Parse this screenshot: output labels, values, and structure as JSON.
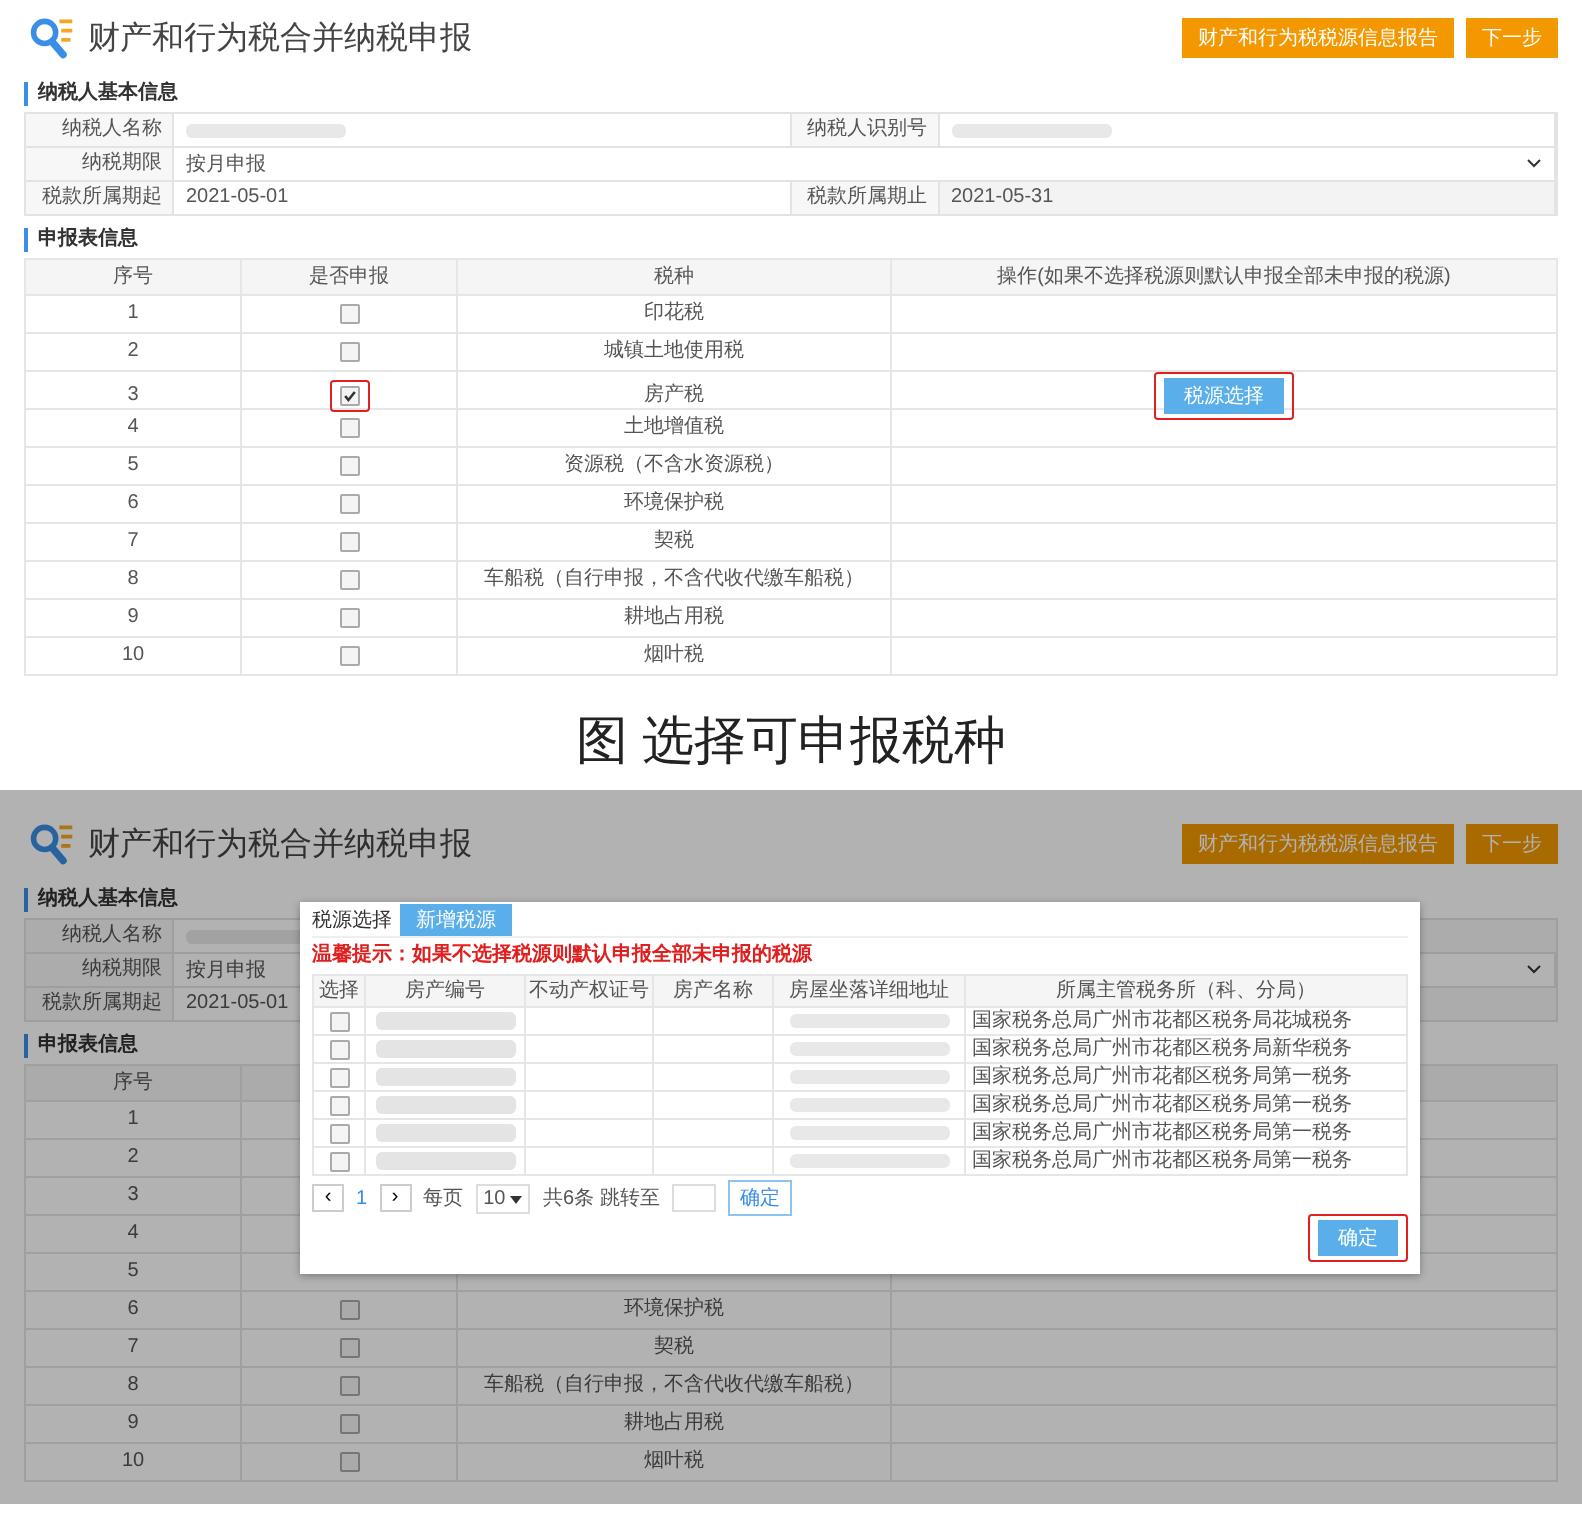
{
  "figure_top": {
    "header": {
      "title": "财产和行为税合并纳税申报",
      "buttons": [
        "财产和行为税税源信息报告",
        "下一步"
      ]
    },
    "taxpayer": {
      "title": "纳税人基本信息",
      "rows": [
        [
          {
            "label": "纳税人名称",
            "kind": "redacted"
          },
          {
            "label": "纳税人识别号",
            "kind": "redacted"
          }
        ],
        [
          {
            "label": "纳税期限",
            "kind": "select",
            "value": "按月申报"
          }
        ],
        [
          {
            "label": "税款所属期起",
            "kind": "text",
            "value": "2021-05-01"
          },
          {
            "label": "税款所属期止",
            "kind": "readonly",
            "value": "2021-05-31"
          }
        ]
      ]
    },
    "declaration": {
      "title": "申报表信息",
      "columns": [
        "序号",
        "是否申报",
        "税种",
        "操作(如果不选择税源则默认申报全部未申报的税源)"
      ],
      "rows": [
        {
          "number": "1",
          "checked": false,
          "highlighted": false,
          "tax": "印花税"
        },
        {
          "number": "2",
          "checked": false,
          "highlighted": false,
          "tax": "城镇土地使用税"
        },
        {
          "number": "3",
          "checked": true,
          "highlighted": true,
          "tax": "房产税",
          "action": "税源选择"
        },
        {
          "number": "4",
          "checked": false,
          "highlighted": false,
          "tax": "土地增值税"
        },
        {
          "number": "5",
          "checked": false,
          "highlighted": false,
          "tax": "资源税（不含水资源税）"
        },
        {
          "number": "6",
          "checked": false,
          "highlighted": false,
          "tax": "环境保护税"
        },
        {
          "number": "7",
          "checked": false,
          "highlighted": false,
          "tax": "契税"
        },
        {
          "number": "8",
          "checked": false,
          "highlighted": false,
          "tax": "车船税（自行申报，不含代收代缴车船税）"
        },
        {
          "number": "9",
          "checked": false,
          "highlighted": false,
          "tax": "耕地占用税"
        },
        {
          "number": "10",
          "checked": false,
          "highlighted": false,
          "tax": "烟叶税"
        }
      ]
    }
  },
  "caption": "图 选择可申报税种",
  "figure_bottom": {
    "header": {
      "title": "财产和行为税合并纳税申报",
      "buttons": [
        "财产和行为税税源信息报告",
        "下一步"
      ]
    },
    "taxpayer": {
      "title": "纳税人基本信息",
      "rows": [
        [
          {
            "label": "纳税人名称",
            "kind": "redacted"
          }
        ],
        [
          {
            "label": "纳税期限",
            "kind": "select",
            "value": "按月申报"
          }
        ],
        [
          {
            "label": "税款所属期起",
            "kind": "text",
            "value": "2021-05-01"
          }
        ]
      ]
    },
    "declaration": {
      "title": "申报表信息",
      "columns": [
        "序号"
      ],
      "rows": [
        {
          "number": "1"
        },
        {
          "number": "2"
        },
        {
          "number": "3"
        },
        {
          "number": "4"
        },
        {
          "number": "5"
        },
        {
          "number": "6",
          "checked": false,
          "highlighted": false,
          "tax": "环境保护税"
        },
        {
          "number": "7",
          "checked": false,
          "highlighted": false,
          "tax": "契税"
        },
        {
          "number": "8",
          "checked": false,
          "highlighted": false,
          "tax": "车船税（自行申报，不含代收代缴车船税）"
        },
        {
          "number": "9",
          "checked": false,
          "highlighted": false,
          "tax": "耕地占用税"
        },
        {
          "number": "10",
          "checked": false,
          "highlighted": false,
          "tax": "烟叶税"
        }
      ]
    },
    "modal": {
      "title": "税源选择",
      "add_button": "新增税源",
      "warning": "温馨提示：如果不选择税源则默认申报全部未申报的税源",
      "columns": [
        "选择",
        "房产编号",
        "不动产权证号",
        "房产名称",
        "房屋坐落详细地址",
        "所属主管税务所（科、分局）"
      ],
      "rows": [
        {
          "checked": false,
          "office": "国家税务总局广州市花都区税务局花城税务"
        },
        {
          "checked": false,
          "office": "国家税务总局广州市花都区税务局新华税务"
        },
        {
          "checked": false,
          "office": "国家税务总局广州市花都区税务局第一税务"
        },
        {
          "checked": false,
          "office": "国家税务总局广州市花都区税务局第一税务"
        },
        {
          "checked": false,
          "office": "国家税务总局广州市花都区税务局第一税务"
        },
        {
          "checked": false,
          "office": "国家税务总局广州市花都区税务局第一税务"
        }
      ],
      "pagination": {
        "prev": "‹",
        "page": "1",
        "next": "›",
        "per_page_label": "每页",
        "per_page": "10",
        "total": "共6条 跳转至",
        "go": "确定"
      },
      "confirm": {
        "label": "确定",
        "highlighted": true
      }
    }
  }
}
